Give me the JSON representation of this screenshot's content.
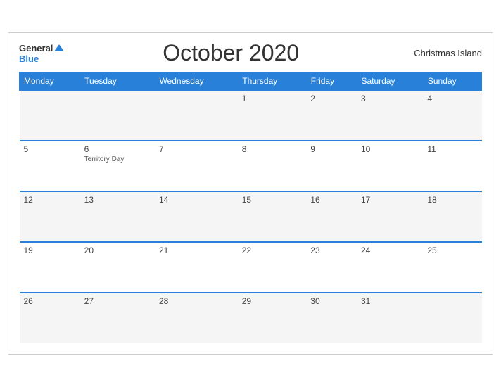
{
  "header": {
    "logo_general": "General",
    "logo_blue": "Blue",
    "title": "October 2020",
    "region": "Christmas Island"
  },
  "days_of_week": [
    "Monday",
    "Tuesday",
    "Wednesday",
    "Thursday",
    "Friday",
    "Saturday",
    "Sunday"
  ],
  "weeks": [
    [
      {
        "day": "",
        "event": ""
      },
      {
        "day": "",
        "event": ""
      },
      {
        "day": "",
        "event": ""
      },
      {
        "day": "1",
        "event": ""
      },
      {
        "day": "2",
        "event": ""
      },
      {
        "day": "3",
        "event": ""
      },
      {
        "day": "4",
        "event": ""
      }
    ],
    [
      {
        "day": "5",
        "event": ""
      },
      {
        "day": "6",
        "event": "Territory Day"
      },
      {
        "day": "7",
        "event": ""
      },
      {
        "day": "8",
        "event": ""
      },
      {
        "day": "9",
        "event": ""
      },
      {
        "day": "10",
        "event": ""
      },
      {
        "day": "11",
        "event": ""
      }
    ],
    [
      {
        "day": "12",
        "event": ""
      },
      {
        "day": "13",
        "event": ""
      },
      {
        "day": "14",
        "event": ""
      },
      {
        "day": "15",
        "event": ""
      },
      {
        "day": "16",
        "event": ""
      },
      {
        "day": "17",
        "event": ""
      },
      {
        "day": "18",
        "event": ""
      }
    ],
    [
      {
        "day": "19",
        "event": ""
      },
      {
        "day": "20",
        "event": ""
      },
      {
        "day": "21",
        "event": ""
      },
      {
        "day": "22",
        "event": ""
      },
      {
        "day": "23",
        "event": ""
      },
      {
        "day": "24",
        "event": ""
      },
      {
        "day": "25",
        "event": ""
      }
    ],
    [
      {
        "day": "26",
        "event": ""
      },
      {
        "day": "27",
        "event": ""
      },
      {
        "day": "28",
        "event": ""
      },
      {
        "day": "29",
        "event": ""
      },
      {
        "day": "30",
        "event": ""
      },
      {
        "day": "31",
        "event": ""
      },
      {
        "day": "",
        "event": ""
      }
    ]
  ]
}
